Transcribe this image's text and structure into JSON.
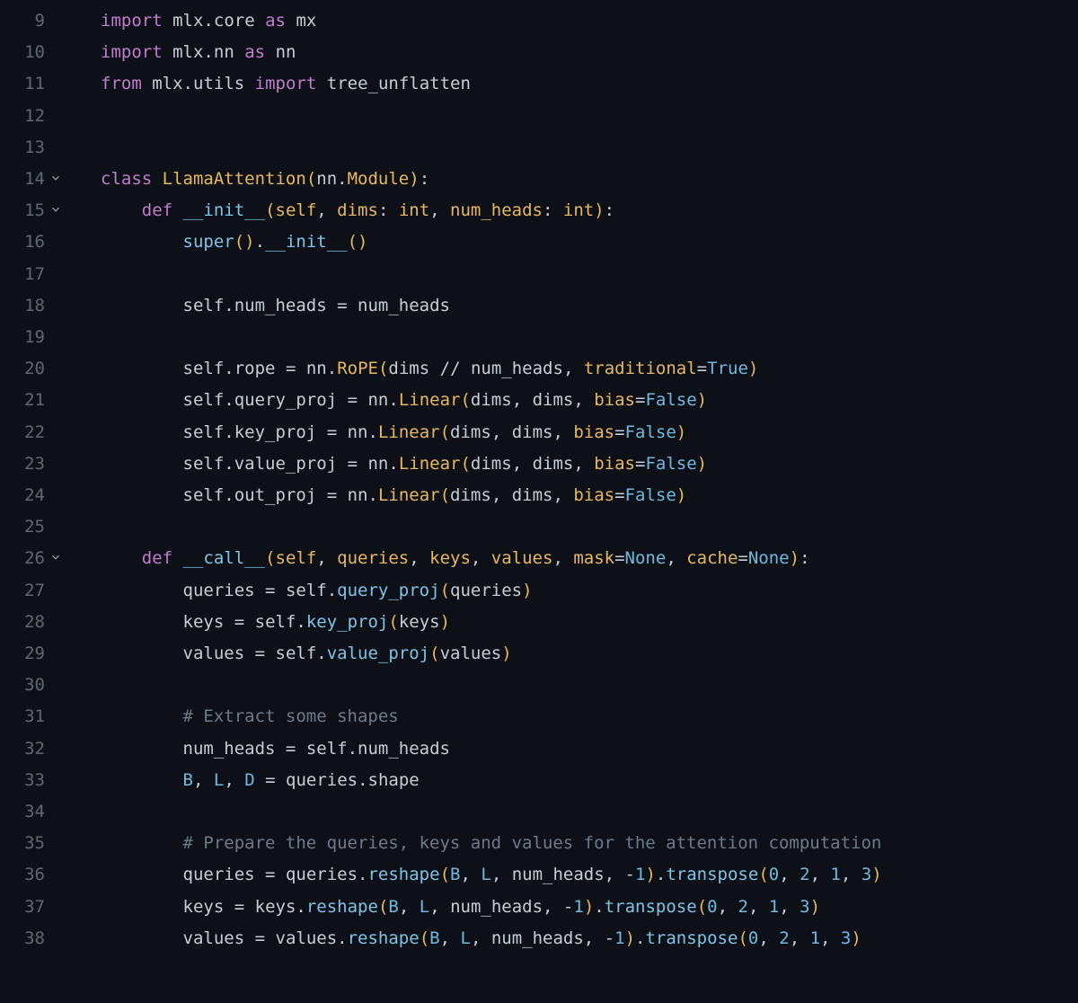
{
  "lines": [
    {
      "n": 9,
      "fold": false
    },
    {
      "n": 10,
      "fold": false
    },
    {
      "n": 11,
      "fold": false
    },
    {
      "n": 12,
      "fold": false
    },
    {
      "n": 13,
      "fold": false
    },
    {
      "n": 14,
      "fold": true
    },
    {
      "n": 15,
      "fold": true
    },
    {
      "n": 16,
      "fold": false
    },
    {
      "n": 17,
      "fold": false
    },
    {
      "n": 18,
      "fold": false
    },
    {
      "n": 19,
      "fold": false
    },
    {
      "n": 20,
      "fold": false
    },
    {
      "n": 21,
      "fold": false
    },
    {
      "n": 22,
      "fold": false
    },
    {
      "n": 23,
      "fold": false
    },
    {
      "n": 24,
      "fold": false
    },
    {
      "n": 25,
      "fold": false
    },
    {
      "n": 26,
      "fold": true
    },
    {
      "n": 27,
      "fold": false
    },
    {
      "n": 28,
      "fold": false
    },
    {
      "n": 29,
      "fold": false
    },
    {
      "n": 30,
      "fold": false
    },
    {
      "n": 31,
      "fold": false
    },
    {
      "n": 32,
      "fold": false
    },
    {
      "n": 33,
      "fold": false
    },
    {
      "n": 34,
      "fold": false
    },
    {
      "n": 35,
      "fold": false
    },
    {
      "n": 36,
      "fold": false
    },
    {
      "n": 37,
      "fold": false
    },
    {
      "n": 38,
      "fold": false
    }
  ],
  "tokens": {
    "l9": [
      [
        "kw",
        "import"
      ],
      [
        "p",
        " "
      ],
      [
        "id",
        "mlx"
      ],
      [
        "p",
        "."
      ],
      [
        "id",
        "core"
      ],
      [
        "p",
        " "
      ],
      [
        "kw",
        "as"
      ],
      [
        "p",
        " "
      ],
      [
        "id",
        "mx"
      ]
    ],
    "l10": [
      [
        "kw",
        "import"
      ],
      [
        "p",
        " "
      ],
      [
        "id",
        "mlx"
      ],
      [
        "p",
        "."
      ],
      [
        "id",
        "nn"
      ],
      [
        "p",
        " "
      ],
      [
        "kw",
        "as"
      ],
      [
        "p",
        " "
      ],
      [
        "id",
        "nn"
      ]
    ],
    "l11": [
      [
        "kw",
        "from"
      ],
      [
        "p",
        " "
      ],
      [
        "id",
        "mlx"
      ],
      [
        "p",
        "."
      ],
      [
        "id",
        "utils"
      ],
      [
        "p",
        " "
      ],
      [
        "kw",
        "import"
      ],
      [
        "p",
        " "
      ],
      [
        "id",
        "tree_unflatten"
      ]
    ],
    "l12": [],
    "l13": [],
    "l14": [
      [
        "kw",
        "class"
      ],
      [
        "p",
        " "
      ],
      [
        "cls",
        "LlamaAttention"
      ],
      [
        "prY",
        "("
      ],
      [
        "id",
        "nn"
      ],
      [
        "p",
        "."
      ],
      [
        "cls",
        "Module"
      ],
      [
        "prY",
        ")"
      ],
      [
        "p",
        ":"
      ]
    ],
    "l15": [
      [
        "p",
        "    "
      ],
      [
        "kw",
        "def"
      ],
      [
        "p",
        " "
      ],
      [
        "magic",
        "__init__"
      ],
      [
        "prY",
        "("
      ],
      [
        "param",
        "self"
      ],
      [
        "p",
        ", "
      ],
      [
        "param",
        "dims"
      ],
      [
        "p",
        ": "
      ],
      [
        "cls",
        "int"
      ],
      [
        "p",
        ", "
      ],
      [
        "param",
        "num_heads"
      ],
      [
        "p",
        ": "
      ],
      [
        "cls",
        "int"
      ],
      [
        "prY",
        ")"
      ],
      [
        "p",
        ":"
      ]
    ],
    "l16": [
      [
        "p",
        "        "
      ],
      [
        "fn",
        "super"
      ],
      [
        "prY",
        "("
      ],
      [
        "prY",
        ")"
      ],
      [
        "p",
        "."
      ],
      [
        "fn",
        "__init__"
      ],
      [
        "prY",
        "("
      ],
      [
        "prY",
        ")"
      ]
    ],
    "l17": [],
    "l18": [
      [
        "p",
        "        "
      ],
      [
        "id",
        "self"
      ],
      [
        "p",
        "."
      ],
      [
        "id",
        "num_heads"
      ],
      [
        "p",
        " "
      ],
      [
        "op",
        "="
      ],
      [
        "p",
        " "
      ],
      [
        "id",
        "num_heads"
      ]
    ],
    "l19": [],
    "l20": [
      [
        "p",
        "        "
      ],
      [
        "id",
        "self"
      ],
      [
        "p",
        "."
      ],
      [
        "id",
        "rope"
      ],
      [
        "p",
        " "
      ],
      [
        "op",
        "="
      ],
      [
        "p",
        " "
      ],
      [
        "id",
        "nn"
      ],
      [
        "p",
        "."
      ],
      [
        "cls",
        "RoPE"
      ],
      [
        "prY",
        "("
      ],
      [
        "id",
        "dims"
      ],
      [
        "p",
        " "
      ],
      [
        "op",
        "//"
      ],
      [
        "p",
        " "
      ],
      [
        "id",
        "num_heads"
      ],
      [
        "p",
        ", "
      ],
      [
        "param",
        "traditional"
      ],
      [
        "op",
        "="
      ],
      [
        "bool",
        "True"
      ],
      [
        "prY",
        ")"
      ]
    ],
    "l21": [
      [
        "p",
        "        "
      ],
      [
        "id",
        "self"
      ],
      [
        "p",
        "."
      ],
      [
        "id",
        "query_proj"
      ],
      [
        "p",
        " "
      ],
      [
        "op",
        "="
      ],
      [
        "p",
        " "
      ],
      [
        "id",
        "nn"
      ],
      [
        "p",
        "."
      ],
      [
        "cls",
        "Linear"
      ],
      [
        "prY",
        "("
      ],
      [
        "id",
        "dims"
      ],
      [
        "p",
        ", "
      ],
      [
        "id",
        "dims"
      ],
      [
        "p",
        ", "
      ],
      [
        "param",
        "bias"
      ],
      [
        "op",
        "="
      ],
      [
        "bool",
        "False"
      ],
      [
        "prY",
        ")"
      ]
    ],
    "l22": [
      [
        "p",
        "        "
      ],
      [
        "id",
        "self"
      ],
      [
        "p",
        "."
      ],
      [
        "id",
        "key_proj"
      ],
      [
        "p",
        " "
      ],
      [
        "op",
        "="
      ],
      [
        "p",
        " "
      ],
      [
        "id",
        "nn"
      ],
      [
        "p",
        "."
      ],
      [
        "cls",
        "Linear"
      ],
      [
        "prY",
        "("
      ],
      [
        "id",
        "dims"
      ],
      [
        "p",
        ", "
      ],
      [
        "id",
        "dims"
      ],
      [
        "p",
        ", "
      ],
      [
        "param",
        "bias"
      ],
      [
        "op",
        "="
      ],
      [
        "bool",
        "False"
      ],
      [
        "prY",
        ")"
      ]
    ],
    "l23": [
      [
        "p",
        "        "
      ],
      [
        "id",
        "self"
      ],
      [
        "p",
        "."
      ],
      [
        "id",
        "value_proj"
      ],
      [
        "p",
        " "
      ],
      [
        "op",
        "="
      ],
      [
        "p",
        " "
      ],
      [
        "id",
        "nn"
      ],
      [
        "p",
        "."
      ],
      [
        "cls",
        "Linear"
      ],
      [
        "prY",
        "("
      ],
      [
        "id",
        "dims"
      ],
      [
        "p",
        ", "
      ],
      [
        "id",
        "dims"
      ],
      [
        "p",
        ", "
      ],
      [
        "param",
        "bias"
      ],
      [
        "op",
        "="
      ],
      [
        "bool",
        "False"
      ],
      [
        "prY",
        ")"
      ]
    ],
    "l24": [
      [
        "p",
        "        "
      ],
      [
        "id",
        "self"
      ],
      [
        "p",
        "."
      ],
      [
        "id",
        "out_proj"
      ],
      [
        "p",
        " "
      ],
      [
        "op",
        "="
      ],
      [
        "p",
        " "
      ],
      [
        "id",
        "nn"
      ],
      [
        "p",
        "."
      ],
      [
        "cls",
        "Linear"
      ],
      [
        "prY",
        "("
      ],
      [
        "id",
        "dims"
      ],
      [
        "p",
        ", "
      ],
      [
        "id",
        "dims"
      ],
      [
        "p",
        ", "
      ],
      [
        "param",
        "bias"
      ],
      [
        "op",
        "="
      ],
      [
        "bool",
        "False"
      ],
      [
        "prY",
        ")"
      ]
    ],
    "l25": [],
    "l26": [
      [
        "p",
        "    "
      ],
      [
        "kw",
        "def"
      ],
      [
        "p",
        " "
      ],
      [
        "magic",
        "__call__"
      ],
      [
        "prY",
        "("
      ],
      [
        "param",
        "self"
      ],
      [
        "p",
        ", "
      ],
      [
        "param",
        "queries"
      ],
      [
        "p",
        ", "
      ],
      [
        "param",
        "keys"
      ],
      [
        "p",
        ", "
      ],
      [
        "param",
        "values"
      ],
      [
        "p",
        ", "
      ],
      [
        "param",
        "mask"
      ],
      [
        "op",
        "="
      ],
      [
        "none",
        "None"
      ],
      [
        "p",
        ", "
      ],
      [
        "param",
        "cache"
      ],
      [
        "op",
        "="
      ],
      [
        "none",
        "None"
      ],
      [
        "prY",
        ")"
      ],
      [
        "p",
        ":"
      ]
    ],
    "l27": [
      [
        "p",
        "        "
      ],
      [
        "id",
        "queries"
      ],
      [
        "p",
        " "
      ],
      [
        "op",
        "="
      ],
      [
        "p",
        " "
      ],
      [
        "id",
        "self"
      ],
      [
        "p",
        "."
      ],
      [
        "fn",
        "query_proj"
      ],
      [
        "prY",
        "("
      ],
      [
        "id",
        "queries"
      ],
      [
        "prY",
        ")"
      ]
    ],
    "l28": [
      [
        "p",
        "        "
      ],
      [
        "id",
        "keys"
      ],
      [
        "p",
        " "
      ],
      [
        "op",
        "="
      ],
      [
        "p",
        " "
      ],
      [
        "id",
        "self"
      ],
      [
        "p",
        "."
      ],
      [
        "fn",
        "key_proj"
      ],
      [
        "prY",
        "("
      ],
      [
        "id",
        "keys"
      ],
      [
        "prY",
        ")"
      ]
    ],
    "l29": [
      [
        "p",
        "        "
      ],
      [
        "id",
        "values"
      ],
      [
        "p",
        " "
      ],
      [
        "op",
        "="
      ],
      [
        "p",
        " "
      ],
      [
        "id",
        "self"
      ],
      [
        "p",
        "."
      ],
      [
        "fn",
        "value_proj"
      ],
      [
        "prY",
        "("
      ],
      [
        "id",
        "values"
      ],
      [
        "prY",
        ")"
      ]
    ],
    "l30": [],
    "l31": [
      [
        "p",
        "        "
      ],
      [
        "cmt",
        "# Extract some shapes"
      ]
    ],
    "l32": [
      [
        "p",
        "        "
      ],
      [
        "id",
        "num_heads"
      ],
      [
        "p",
        " "
      ],
      [
        "op",
        "="
      ],
      [
        "p",
        " "
      ],
      [
        "id",
        "self"
      ],
      [
        "p",
        "."
      ],
      [
        "id",
        "num_heads"
      ]
    ],
    "l33": [
      [
        "p",
        "        "
      ],
      [
        "bcap",
        "B"
      ],
      [
        "p",
        ", "
      ],
      [
        "bcap",
        "L"
      ],
      [
        "p",
        ", "
      ],
      [
        "bcap",
        "D"
      ],
      [
        "p",
        " "
      ],
      [
        "op",
        "="
      ],
      [
        "p",
        " "
      ],
      [
        "id",
        "queries"
      ],
      [
        "p",
        "."
      ],
      [
        "id",
        "shape"
      ]
    ],
    "l34": [],
    "l35": [
      [
        "p",
        "        "
      ],
      [
        "cmt",
        "# Prepare the queries, keys and values for the attention computation"
      ]
    ],
    "l36": [
      [
        "p",
        "        "
      ],
      [
        "id",
        "queries"
      ],
      [
        "p",
        " "
      ],
      [
        "op",
        "="
      ],
      [
        "p",
        " "
      ],
      [
        "id",
        "queries"
      ],
      [
        "p",
        "."
      ],
      [
        "fn",
        "reshape"
      ],
      [
        "prY",
        "("
      ],
      [
        "bcap",
        "B"
      ],
      [
        "p",
        ", "
      ],
      [
        "bcap",
        "L"
      ],
      [
        "p",
        ", "
      ],
      [
        "id",
        "num_heads"
      ],
      [
        "p",
        ", "
      ],
      [
        "op",
        "-"
      ],
      [
        "num",
        "1"
      ],
      [
        "prY",
        ")"
      ],
      [
        "p",
        "."
      ],
      [
        "fn",
        "transpose"
      ],
      [
        "prY",
        "("
      ],
      [
        "num",
        "0"
      ],
      [
        "p",
        ", "
      ],
      [
        "num",
        "2"
      ],
      [
        "p",
        ", "
      ],
      [
        "num",
        "1"
      ],
      [
        "p",
        ", "
      ],
      [
        "num",
        "3"
      ],
      [
        "prY",
        ")"
      ]
    ],
    "l37": [
      [
        "p",
        "        "
      ],
      [
        "id",
        "keys"
      ],
      [
        "p",
        " "
      ],
      [
        "op",
        "="
      ],
      [
        "p",
        " "
      ],
      [
        "id",
        "keys"
      ],
      [
        "p",
        "."
      ],
      [
        "fn",
        "reshape"
      ],
      [
        "prY",
        "("
      ],
      [
        "bcap",
        "B"
      ],
      [
        "p",
        ", "
      ],
      [
        "bcap",
        "L"
      ],
      [
        "p",
        ", "
      ],
      [
        "id",
        "num_heads"
      ],
      [
        "p",
        ", "
      ],
      [
        "op",
        "-"
      ],
      [
        "num",
        "1"
      ],
      [
        "prY",
        ")"
      ],
      [
        "p",
        "."
      ],
      [
        "fn",
        "transpose"
      ],
      [
        "prY",
        "("
      ],
      [
        "num",
        "0"
      ],
      [
        "p",
        ", "
      ],
      [
        "num",
        "2"
      ],
      [
        "p",
        ", "
      ],
      [
        "num",
        "1"
      ],
      [
        "p",
        ", "
      ],
      [
        "num",
        "3"
      ],
      [
        "prY",
        ")"
      ]
    ],
    "l38": [
      [
        "p",
        "        "
      ],
      [
        "id",
        "values"
      ],
      [
        "p",
        " "
      ],
      [
        "op",
        "="
      ],
      [
        "p",
        " "
      ],
      [
        "id",
        "values"
      ],
      [
        "p",
        "."
      ],
      [
        "fn",
        "reshape"
      ],
      [
        "prY",
        "("
      ],
      [
        "bcap",
        "B"
      ],
      [
        "p",
        ", "
      ],
      [
        "bcap",
        "L"
      ],
      [
        "p",
        ", "
      ],
      [
        "id",
        "num_heads"
      ],
      [
        "p",
        ", "
      ],
      [
        "op",
        "-"
      ],
      [
        "num",
        "1"
      ],
      [
        "prY",
        ")"
      ],
      [
        "p",
        "."
      ],
      [
        "fn",
        "transpose"
      ],
      [
        "prY",
        "("
      ],
      [
        "num",
        "0"
      ],
      [
        "p",
        ", "
      ],
      [
        "num",
        "2"
      ],
      [
        "p",
        ", "
      ],
      [
        "num",
        "1"
      ],
      [
        "p",
        ", "
      ],
      [
        "num",
        "3"
      ],
      [
        "prY",
        ")"
      ]
    ]
  }
}
